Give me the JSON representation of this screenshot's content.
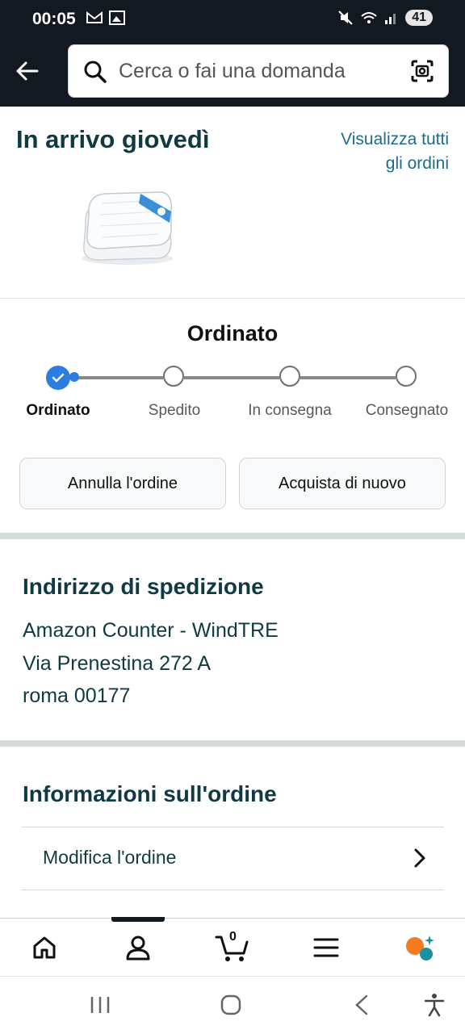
{
  "status_bar": {
    "time": "00:05",
    "battery": "41"
  },
  "search": {
    "placeholder": "Cerca o fai una domanda"
  },
  "arrival": {
    "title": "In arrivo giovedì",
    "view_all_line1": "Visualizza tutti",
    "view_all_line2": "gli ordini"
  },
  "progress": {
    "title": "Ordinato",
    "steps": [
      "Ordinato",
      "Spedito",
      "In consegna",
      "Consegnato"
    ],
    "current_step_index": 0
  },
  "buttons": {
    "cancel": "Annulla l'ordine",
    "buy_again": "Acquista di nuovo"
  },
  "shipping": {
    "title": "Indirizzo di spedizione",
    "lines": [
      "Amazon Counter - WindTRE",
      "Via Prenestina 272 A",
      "roma 00177"
    ]
  },
  "order_info": {
    "title": "Informazioni sull'ordine",
    "edit_label": "Modifica l'ordine"
  },
  "bottom_nav": {
    "items": [
      "home-icon",
      "account-icon",
      "cart-icon",
      "menu-icon",
      "rufus-icon"
    ],
    "cart_count": "0"
  },
  "colors": {
    "header_bg": "#131921",
    "accent_blue": "#2A7DE1",
    "link": "#1E6B8C",
    "heading": "#0F3A44"
  }
}
